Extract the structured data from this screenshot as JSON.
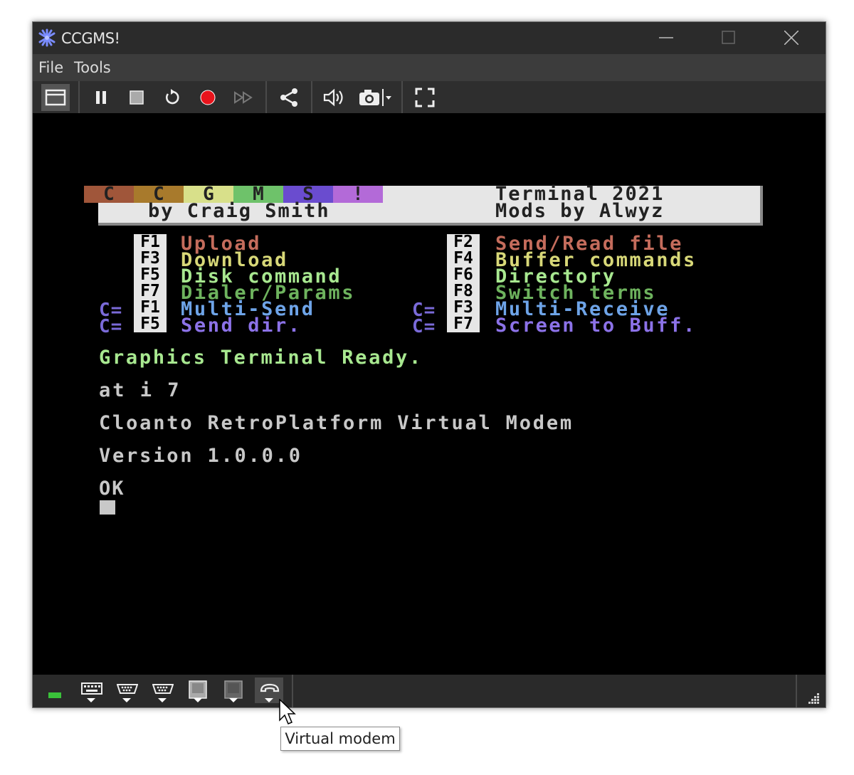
{
  "window": {
    "title": "CCGMS!"
  },
  "menu": {
    "items": [
      "File",
      "Tools"
    ]
  },
  "toolbar": {
    "buttons": [
      "window-view",
      "pause",
      "stop",
      "reset",
      "record",
      "fast-forward",
      "share",
      "volume",
      "screenshot",
      "fullscreen"
    ]
  },
  "banner": {
    "logo_letters": [
      "C",
      "C",
      "G",
      "M",
      "S",
      "!"
    ],
    "logo_colors": [
      "#a0563a",
      "#a87a2c",
      "#d8e08a",
      "#6ec26a",
      "#6a4ccf",
      "#b36ad8"
    ],
    "byline": "by Craig Smith",
    "title_right": "Terminal 2021",
    "mods_right": "Mods by Alwyz"
  },
  "menu_keys": {
    "left": [
      {
        "key": "F1",
        "label": "Upload",
        "color": "#c46c5c",
        "prefix": ""
      },
      {
        "key": "F3",
        "label": "Download",
        "color": "#d8d878",
        "prefix": ""
      },
      {
        "key": "F5",
        "label": "Disk command",
        "color": "#a8e890",
        "prefix": ""
      },
      {
        "key": "F7",
        "label": "Dialer/Params",
        "color": "#6eb35e",
        "prefix": ""
      },
      {
        "key": "F1",
        "label": "Multi-Send",
        "color": "#6ea4e8",
        "prefix": "C="
      },
      {
        "key": "F5",
        "label": "Send dir.",
        "color": "#8c72e8",
        "prefix": "C="
      }
    ],
    "right": [
      {
        "key": "F2",
        "label": "Send/Read file",
        "color": "#c46c5c",
        "prefix": ""
      },
      {
        "key": "F4",
        "label": "Buffer commands",
        "color": "#d8d878",
        "prefix": ""
      },
      {
        "key": "F6",
        "label": "Directory",
        "color": "#a8e890",
        "prefix": ""
      },
      {
        "key": "F8",
        "label": "Switch terms",
        "color": "#6eb35e",
        "prefix": ""
      },
      {
        "key": "F3",
        "label": "Multi-Receive",
        "color": "#6ea4e8",
        "prefix": "C="
      },
      {
        "key": "F7",
        "label": "Screen to Buff.",
        "color": "#8c72e8",
        "prefix": "C="
      }
    ],
    "prefix_color": "#7a6ad8"
  },
  "terminal": {
    "ready": "Graphics Terminal Ready.",
    "command": "at i 7",
    "modem_name": "Cloanto RetroPlatform Virtual Modem",
    "version": "Version 1.0.0.0",
    "ok": "OK",
    "ready_color": "#a8e890",
    "text_color": "#c8c8c8"
  },
  "statusbar": {
    "items": [
      "power-led",
      "keyboard",
      "joystick-port-1",
      "joystick-port-2",
      "disk-drive-8",
      "disk-drive-9",
      "virtual-modem"
    ]
  },
  "tooltip": {
    "text": "Virtual modem"
  }
}
